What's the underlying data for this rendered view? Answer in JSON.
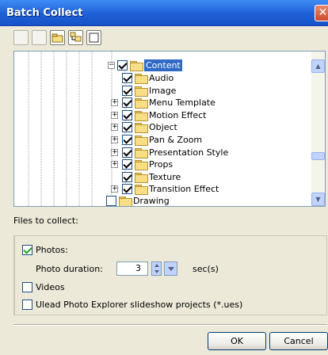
{
  "window": {
    "title": "Batch Collect",
    "close_label": "✕"
  },
  "tree": {
    "items": [
      {
        "label": "Content",
        "checked": true,
        "selected": true
      },
      {
        "label": "Audio",
        "checked": true
      },
      {
        "label": "Image",
        "checked": true
      },
      {
        "label": "Menu Template",
        "checked": true
      },
      {
        "label": "Motion Effect",
        "checked": true
      },
      {
        "label": "Object",
        "checked": true
      },
      {
        "label": "Pan & Zoom",
        "checked": true
      },
      {
        "label": "Presentation Style",
        "checked": true
      },
      {
        "label": "Props",
        "checked": true
      },
      {
        "label": "Texture",
        "checked": true
      },
      {
        "label": "Transition Effect",
        "checked": true
      },
      {
        "label": "Drawing",
        "checked": false
      }
    ]
  },
  "files": {
    "header": "Files to collect:",
    "photos_label": "Photos:",
    "photos_checked": true,
    "duration_label": "Photo duration:",
    "duration_value": "3",
    "duration_unit": "sec(s)",
    "videos_label": "Videos",
    "ues_label": "Ulead Photo Explorer slideshow projects (*.ues)"
  },
  "buttons": {
    "ok": "OK",
    "cancel": "Cancel"
  }
}
